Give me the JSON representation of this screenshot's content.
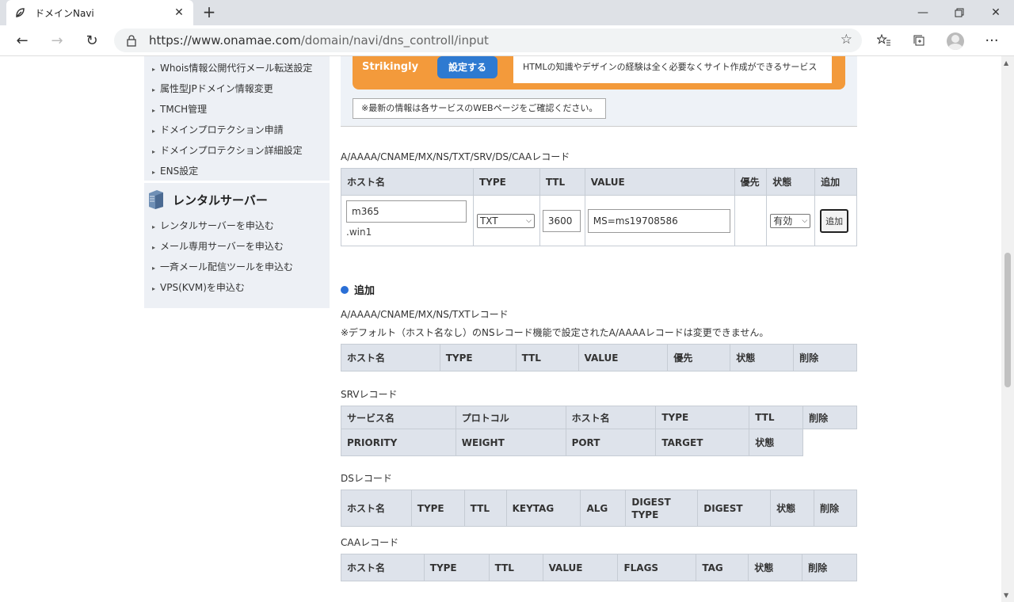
{
  "browser": {
    "tab_title": "ドメインNavi",
    "url_host": "https://www.onamae.com",
    "url_path": "/domain/navi/dns_controll/input"
  },
  "sidebar": {
    "items_top": [
      "Whois情報公開代行メール転送設定",
      "属性型JPドメイン情報変更",
      "TMCH管理",
      "ドメインプロテクション申請",
      "ドメインプロテクション詳細設定",
      "ENS設定"
    ],
    "rental_heading": "レンタルサーバー",
    "items_rental": [
      "レンタルサーバーを申込む",
      "メール専用サーバーを申込む",
      "一斉メール配信ツールを申込む",
      "VPS(KVM)を申込む"
    ]
  },
  "promo": {
    "name": "Strikingly",
    "button": "設定する",
    "description": "HTMLの知識やデザインの経験は全く必要なくサイト作成ができるサービス",
    "notice": "※最新の情報は各サービスのWEBページをご確認ください。"
  },
  "input_section": {
    "label": "A/AAAA/CNAME/MX/NS/TXT/SRV/DS/CAAレコード",
    "headers": [
      "ホスト名",
      "TYPE",
      "TTL",
      "VALUE",
      "優先",
      "状態",
      "追加"
    ],
    "host_value": "m365",
    "host_suffix": ".win1",
    "type_value": "TXT",
    "ttl_value": "3600",
    "value_value": "MS=ms19708586",
    "status_value": "有効",
    "add_button": "追加"
  },
  "added_section": {
    "heading": "追加",
    "a_label": "A/AAAA/CNAME/MX/NS/TXTレコード",
    "a_note": "※デフォルト（ホスト名なし）のNSレコード機能で設定されたA/AAAAレコードは変更できません。",
    "a_headers": [
      "ホスト名",
      "TYPE",
      "TTL",
      "VALUE",
      "優先",
      "状態",
      "削除"
    ],
    "srv_label": "SRVレコード",
    "srv_headers_1": [
      "サービス名",
      "プロトコル",
      "ホスト名",
      "TYPE",
      "TTL",
      "削除"
    ],
    "srv_headers_2": [
      "PRIORITY",
      "WEIGHT",
      "PORT",
      "TARGET",
      "状態"
    ],
    "ds_label": "DSレコード",
    "ds_headers": [
      "ホスト名",
      "TYPE",
      "TTL",
      "KEYTAG",
      "ALG",
      "DIGEST TYPE",
      "DIGEST",
      "状態",
      "削除"
    ],
    "caa_label": "CAAレコード",
    "caa_headers": [
      "ホスト名",
      "TYPE",
      "TTL",
      "VALUE",
      "FLAGS",
      "TAG",
      "状態",
      "削除"
    ]
  }
}
